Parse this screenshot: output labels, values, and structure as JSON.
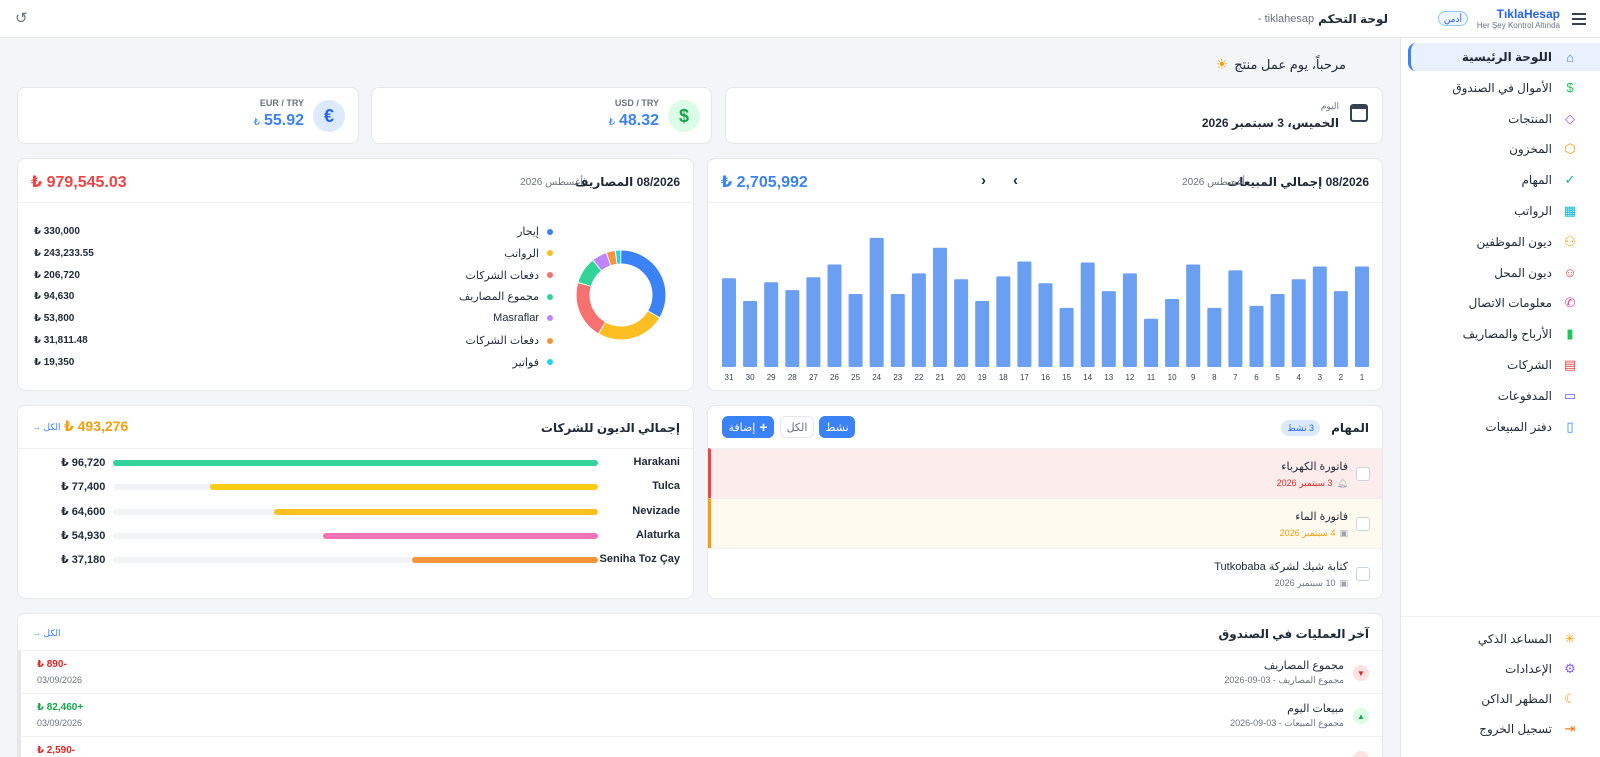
{
  "topbar": {
    "brand": "TıklaHesap",
    "tagline": "Her Şey Kontrol Altında",
    "role_badge": "أدمن",
    "page_title": "لوحة التحكم",
    "page_subtitle": "tiklahesap -"
  },
  "sidebar": {
    "items": [
      {
        "label": "اللوحة الرئيسية",
        "icon": "home-icon",
        "color": "#3b82f6",
        "active": true
      },
      {
        "label": "الأموال في الصندوق",
        "icon": "dollar-icon",
        "color": "#22c55e"
      },
      {
        "label": "المنتجات",
        "icon": "tag-icon",
        "color": "#a855f7"
      },
      {
        "label": "المخزون",
        "icon": "box-icon",
        "color": "#f59e0b"
      },
      {
        "label": "المهام",
        "icon": "check-icon",
        "color": "#10b981"
      },
      {
        "label": "الرواتب",
        "icon": "grid-icon",
        "color": "#06b6d4"
      },
      {
        "label": "ديون الموظفين",
        "icon": "users-icon",
        "color": "#f59e0b"
      },
      {
        "label": "ديون المحل",
        "icon": "user-icon",
        "color": "#ef4444"
      },
      {
        "label": "معلومات الاتصال",
        "icon": "phone-icon",
        "color": "#ec4899"
      },
      {
        "label": "الأرباح والمصاريف",
        "icon": "bar-chart-icon",
        "color": "#22c55e"
      },
      {
        "label": "الشركات",
        "icon": "building-icon",
        "color": "#ef4444"
      },
      {
        "label": "المدفوعات",
        "icon": "card-icon",
        "color": "#6366f1"
      },
      {
        "label": "دفتر المبيعات",
        "icon": "document-icon",
        "color": "#3b82f6"
      }
    ],
    "bottom_items": [
      {
        "label": "المساعد الذكي",
        "icon": "sparkle-icon",
        "color": "#f59e0b"
      },
      {
        "label": "الإعدادات",
        "icon": "gear-icon",
        "color": "#8b5cf6"
      },
      {
        "label": "المظهر الداكن",
        "icon": "moon-icon",
        "color": "#f59e0b"
      },
      {
        "label": "تسجيل الخروج",
        "icon": "logout-icon",
        "color": "#f97316"
      }
    ]
  },
  "welcome": "مرحباً، يوم عمل منتج",
  "date_card": {
    "label": "اليوم",
    "value": "الخميس، 3 سبتمبر 2026"
  },
  "usd_card": {
    "label": "USD / TRY",
    "value": "48.32",
    "currency": "₺"
  },
  "eur_card": {
    "label": "EUR / TRY",
    "value": "55.92",
    "currency": "₺"
  },
  "sales": {
    "title": "08/2026 إجمالي المبيعات",
    "period": "أغسطس 2026",
    "total": "₺ 2,705,992",
    "prev": "‹",
    "next": "›"
  },
  "chart_data": {
    "type": "bar",
    "categories": [
      "31",
      "30",
      "29",
      "28",
      "27",
      "26",
      "25",
      "24",
      "23",
      "22",
      "21",
      "20",
      "19",
      "18",
      "17",
      "16",
      "15",
      "14",
      "13",
      "12",
      "11",
      "10",
      "9",
      "8",
      "7",
      "6",
      "5",
      "4",
      "3",
      "2",
      "1"
    ],
    "values": [
      90,
      67,
      86,
      78,
      91,
      104,
      74,
      131,
      74,
      95,
      121,
      89,
      67,
      92,
      107,
      85,
      60,
      106,
      77,
      95,
      49,
      69,
      104,
      60,
      98,
      62,
      74,
      89,
      102,
      77,
      102
    ],
    "color": "#6b9ff2"
  },
  "expenses": {
    "title": "08/2026 المصاريف",
    "period": "أغسطس 2026",
    "total": "₺ 979,545.03",
    "items": [
      {
        "label": "إيجار",
        "value": "₺ 330,000",
        "amount": 330000,
        "color": "#3b82f6"
      },
      {
        "label": "الرواتب",
        "value": "₺ 243,233.55",
        "amount": 243233.55,
        "color": "#fbbf24"
      },
      {
        "label": "دفعات الشركات",
        "value": "₺ 206,720",
        "amount": 206720,
        "color": "#f87171"
      },
      {
        "label": "مجموع المصاريف",
        "value": "₺ 94,630",
        "amount": 94630,
        "color": "#34d399"
      },
      {
        "label": "Masraflar",
        "value": "₺ 53,800",
        "amount": 53800,
        "color": "#c084fc"
      },
      {
        "label": "دفعات الشركات",
        "value": "₺ 31,811.48",
        "amount": 31811.48,
        "color": "#fb923c"
      },
      {
        "label": "فواتير",
        "value": "₺ 19,350",
        "amount": 19350,
        "color": "#22d3ee"
      }
    ]
  },
  "tasks": {
    "title": "المهام",
    "badge": "3 نشط",
    "filter_active": "نشط",
    "filter_all": "الكل",
    "add_label": "إضافة",
    "items": [
      {
        "title": "فاتورة الكهرباء",
        "date": "3 سبتمبر 2026",
        "state": "overdue",
        "icon": "bell-icon"
      },
      {
        "title": "فاتورة الماء",
        "date": "4 سبتمبر 2026",
        "state": "soon",
        "icon": "calendar-icon"
      },
      {
        "title": "كتابة شيك لشركة Tutkobaba",
        "date": "10 سبتمبر 2026",
        "state": "normal",
        "icon": "calendar-icon"
      }
    ]
  },
  "debts": {
    "title": "إجمالي الديون للشركات",
    "total": "₺ 493,276",
    "all_link": "الكل →",
    "items": [
      {
        "name": "Harakani",
        "value": "₺ 96,720",
        "amount": 96720,
        "color": "#34d399"
      },
      {
        "name": "Tulca",
        "value": "₺ 77,400",
        "amount": 77400,
        "color": "#facc15"
      },
      {
        "name": "Nevizade",
        "value": "₺ 64,600",
        "amount": 64600,
        "color": "#fbbf24"
      },
      {
        "name": "Alaturka",
        "value": "₺ 54,930",
        "amount": 54930,
        "color": "#f472b6"
      },
      {
        "name": "Seniha Toz Çay",
        "value": "₺ 37,180",
        "amount": 37180,
        "color": "#fb923c"
      }
    ]
  },
  "transactions": {
    "title": "آخر العمليات في الصندوق",
    "all_link": "الكل →",
    "items": [
      {
        "title": "مجموع المصاريف",
        "sub": "مجموع المصاريف - 03-09-2026",
        "amount": "-890 ₺",
        "date": "03/09/2026",
        "type": "out"
      },
      {
        "title": "مبيعات اليوم",
        "sub": "مجموع المبيعات - 03-09-2026",
        "amount": "+82,460 ₺",
        "date": "03/09/2026",
        "type": "in"
      },
      {
        "title": "",
        "sub": "",
        "amount": "-2,590 ₺",
        "date": "",
        "type": "out"
      }
    ]
  }
}
